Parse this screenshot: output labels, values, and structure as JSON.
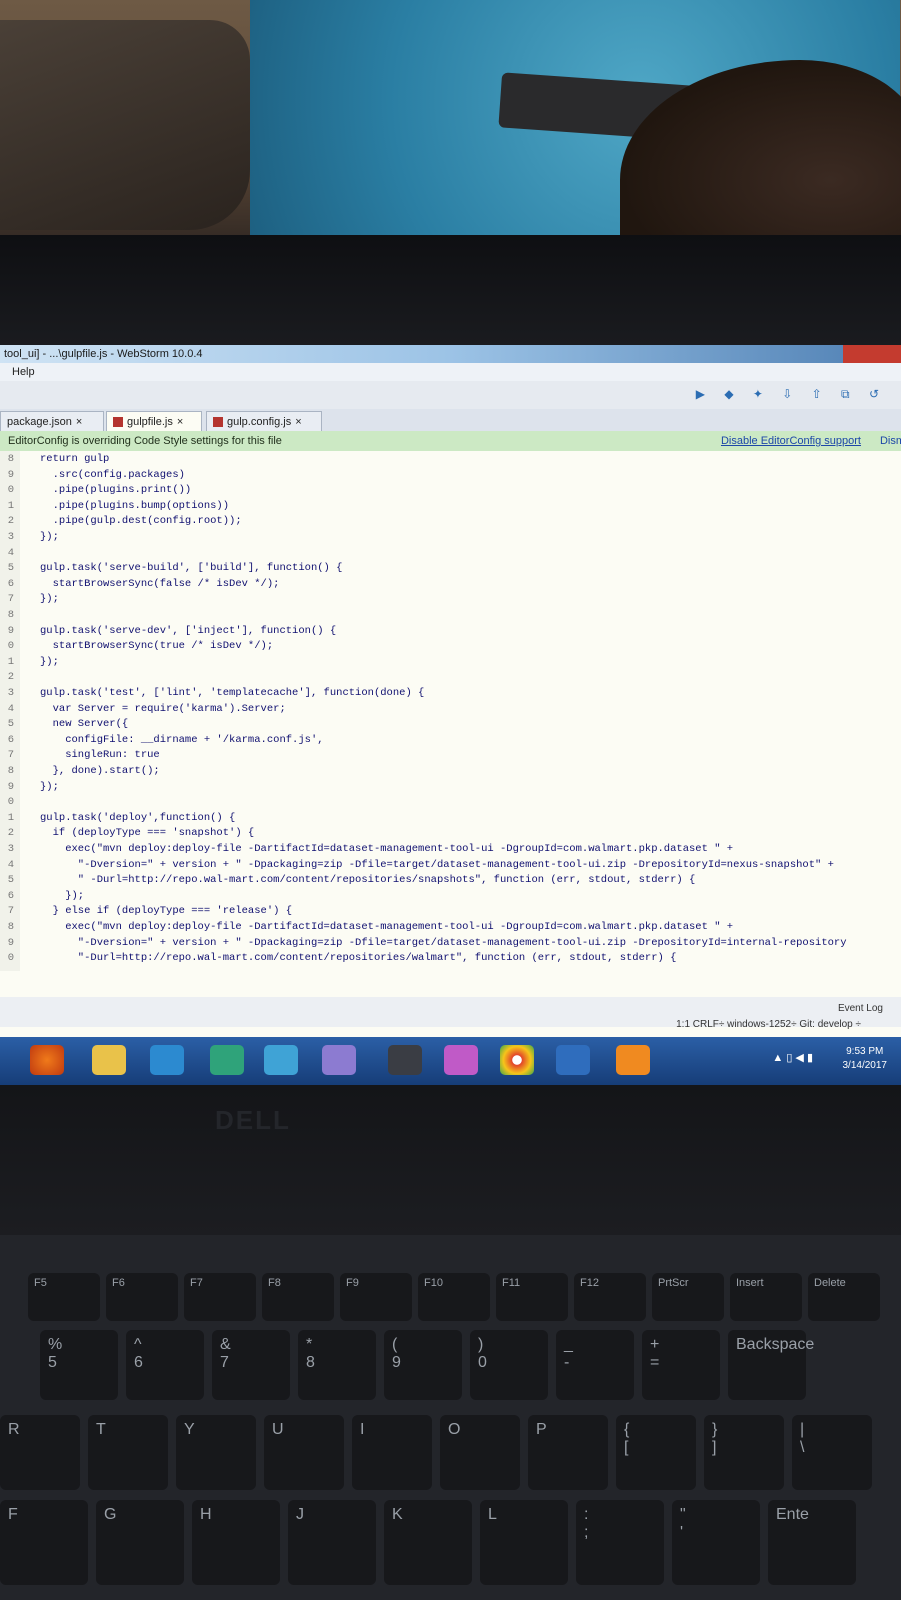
{
  "window": {
    "title": "tool_ui] - ...\\gulpfile.js - WebStorm 10.0.4",
    "menu": "Help"
  },
  "tabs": [
    {
      "label": "package.json",
      "close": "×"
    },
    {
      "label": "gulpfile.js",
      "close": "×"
    },
    {
      "label": "gulp.config.js",
      "close": "×"
    }
  ],
  "notice": {
    "text": "EditorConfig is overriding Code Style settings for this file",
    "link": "Disable EditorConfig support",
    "dismiss": "Dism"
  },
  "code": [
    {
      "ln": "8",
      "text": "return gulp"
    },
    {
      "ln": "9",
      "text": "  .src(config.packages)"
    },
    {
      "ln": "0",
      "text": "  .pipe(plugins.print())"
    },
    {
      "ln": "1",
      "text": "  .pipe(plugins.bump(options))"
    },
    {
      "ln": "2",
      "text": "  .pipe(gulp.dest(config.root));"
    },
    {
      "ln": "3",
      "text": "});"
    },
    {
      "ln": "4",
      "text": ""
    },
    {
      "ln": "5",
      "text": "gulp.task('serve-build', ['build'], function() {"
    },
    {
      "ln": "6",
      "text": "  startBrowserSync(false /* isDev */);"
    },
    {
      "ln": "7",
      "text": "});"
    },
    {
      "ln": "8",
      "text": ""
    },
    {
      "ln": "9",
      "text": "gulp.task('serve-dev', ['inject'], function() {"
    },
    {
      "ln": "0",
      "text": "  startBrowserSync(true /* isDev */);"
    },
    {
      "ln": "1",
      "text": "});"
    },
    {
      "ln": "2",
      "text": ""
    },
    {
      "ln": "3",
      "text": "gulp.task('test', ['lint', 'templatecache'], function(done) {"
    },
    {
      "ln": "4",
      "text": "  var Server = require('karma').Server;"
    },
    {
      "ln": "5",
      "text": "  new Server({"
    },
    {
      "ln": "6",
      "text": "    configFile: __dirname + '/karma.conf.js',"
    },
    {
      "ln": "7",
      "text": "    singleRun: true"
    },
    {
      "ln": "8",
      "text": "  }, done).start();"
    },
    {
      "ln": "9",
      "text": "});"
    },
    {
      "ln": "0",
      "text": ""
    },
    {
      "ln": "1",
      "text": "gulp.task('deploy',function() {"
    },
    {
      "ln": "2",
      "text": "  if (deployType === 'snapshot') {"
    },
    {
      "ln": "3",
      "text": "    exec(\"mvn deploy:deploy-file -DartifactId=dataset-management-tool-ui -DgroupId=com.walmart.pkp.dataset \" +"
    },
    {
      "ln": "4",
      "text": "      \"-Dversion=\" + version + \" -Dpackaging=zip -Dfile=target/dataset-management-tool-ui.zip -DrepositoryId=nexus-snapshot\" +"
    },
    {
      "ln": "5",
      "text": "      \" -Durl=http://repo.wal-mart.com/content/repositories/snapshots\", function (err, stdout, stderr) {"
    },
    {
      "ln": "6",
      "text": "    });"
    },
    {
      "ln": "7",
      "text": "  } else if (deployType === 'release') {"
    },
    {
      "ln": "8",
      "text": "    exec(\"mvn deploy:deploy-file -DartifactId=dataset-management-tool-ui -DgroupId=com.walmart.pkp.dataset \" +"
    },
    {
      "ln": "9",
      "text": "      \"-Dversion=\" + version + \" -Dpackaging=zip -Dfile=target/dataset-management-tool-ui.zip -DrepositoryId=internal-repository"
    },
    {
      "ln": "0",
      "text": "      \"-Durl=http://repo.wal-mart.com/content/repositories/walmart\", function (err, stdout, stderr) {"
    }
  ],
  "status": {
    "event_log": "Event Log",
    "info": "1:1  CRLF÷  windows-1252÷  Git: develop ÷"
  },
  "taskbar": {
    "time": "9:53 PM",
    "date": "3/14/2017"
  },
  "laptop": {
    "logo": "DELL"
  },
  "keys": {
    "fn": [
      "F5",
      "F6",
      "F7",
      "F8",
      "F9",
      "F10",
      "F11",
      "F12",
      "PrtScr",
      "Insert",
      "Delete"
    ],
    "numbers": [
      "%\n5",
      "^\n6",
      "&\n7",
      "*\n8",
      "(\n9",
      ")\n0",
      "_\n-",
      "+\n=",
      "Backspace"
    ],
    "row2": [
      "R",
      "T",
      "Y",
      "U",
      "I",
      "O",
      "P",
      "{\n[",
      "}\n]",
      "|\n\\"
    ],
    "row3": [
      "F",
      "G",
      "H",
      "J",
      "K",
      "L",
      ":\n;",
      "\"\n'",
      "Ente"
    ]
  }
}
